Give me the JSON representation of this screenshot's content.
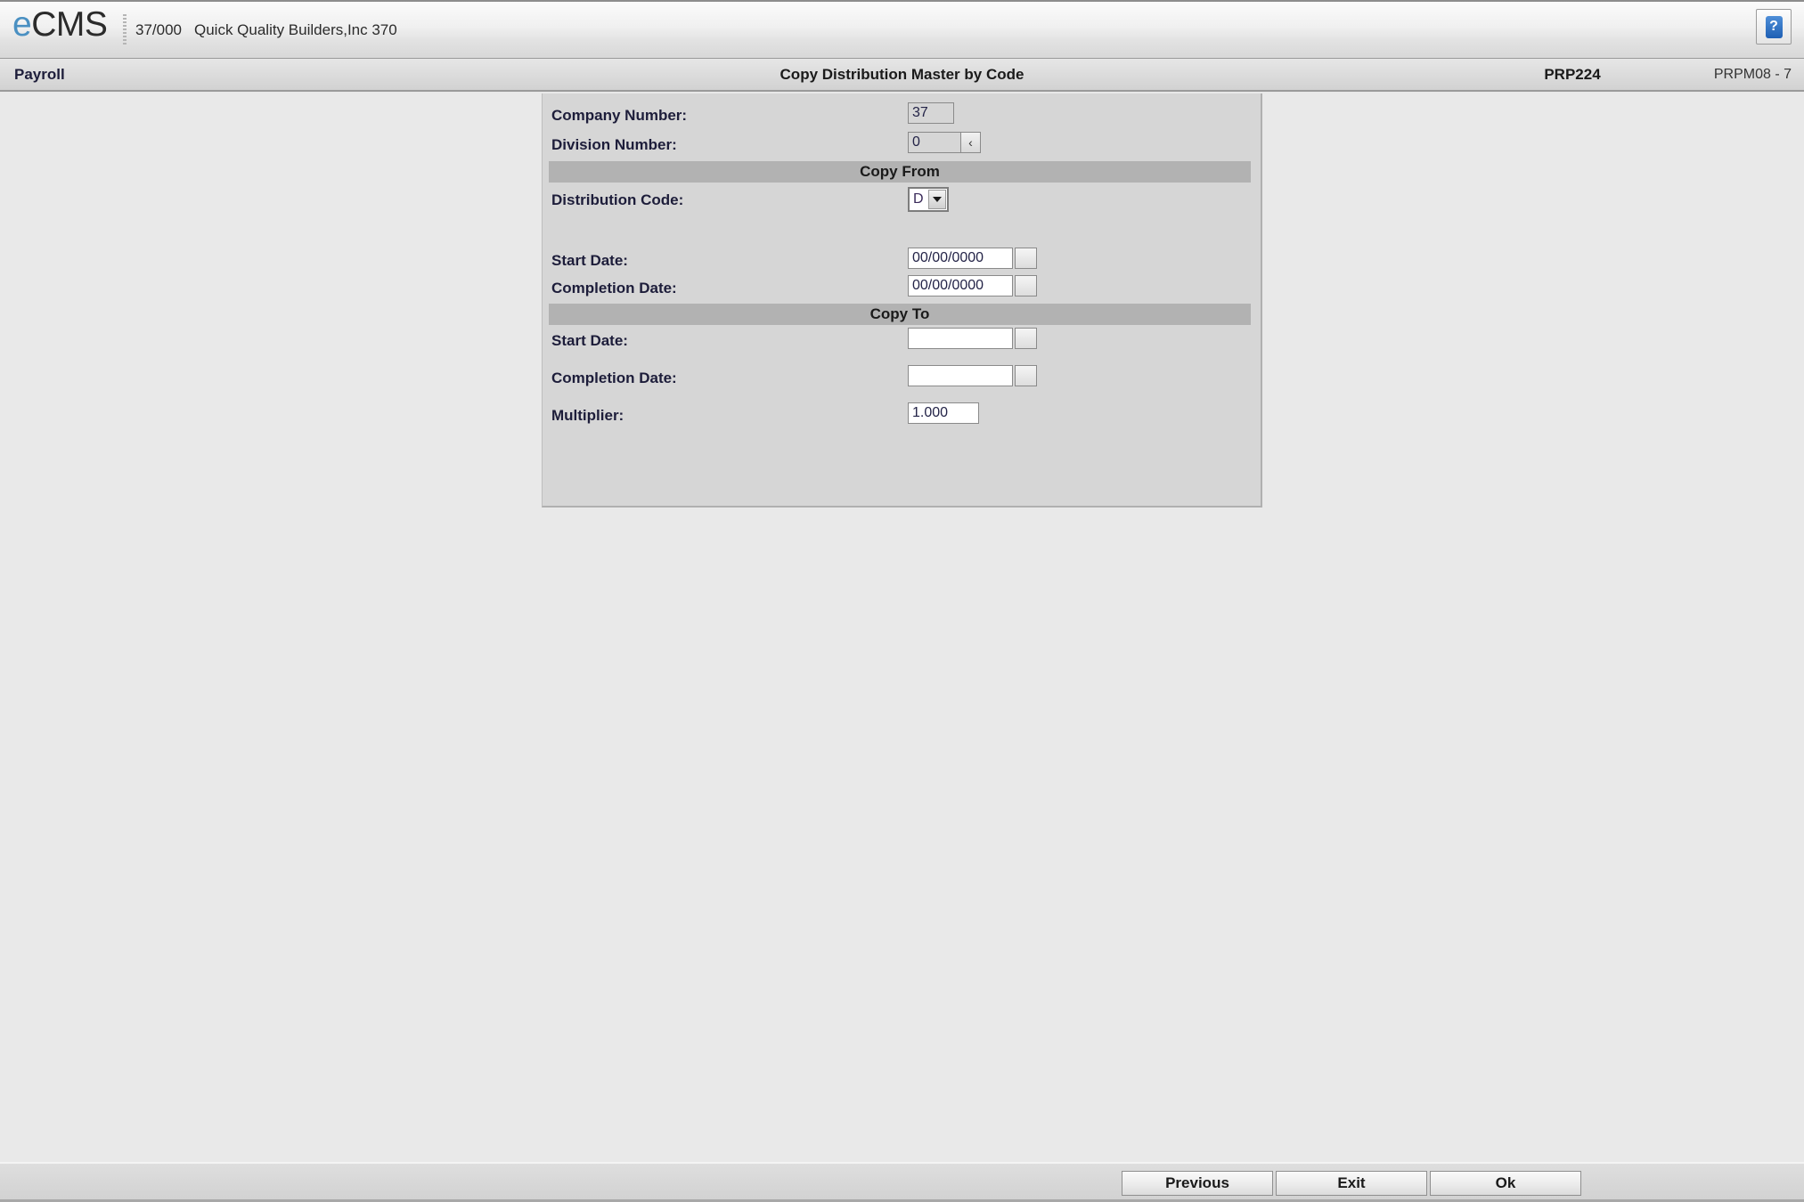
{
  "brand": {
    "logo_e": "e",
    "logo_cms": "CMS",
    "company_code": "37/000",
    "company_name": "Quick Quality Builders,Inc 370",
    "help_glyph": "?"
  },
  "titlebar": {
    "module": "Payroll",
    "screen_title": "Copy Distribution Master by Code",
    "program_id": "PRP224",
    "session_id": "PRPM08 - 7"
  },
  "form": {
    "company_number": {
      "label": "Company Number:",
      "value": "37"
    },
    "division_number": {
      "label": "Division Number:",
      "value": "0",
      "lookup_glyph": "‹"
    },
    "copy_from_band": "Copy From",
    "distribution_code": {
      "label": "Distribution Code:",
      "value": "D",
      "options": [
        "D"
      ]
    },
    "from_start_date": {
      "label": "Start Date:",
      "value": "00/00/0000",
      "placeholder": ""
    },
    "from_completion_date": {
      "label": "Completion Date:",
      "value": "00/00/0000",
      "placeholder": ""
    },
    "copy_to_band": "Copy To",
    "to_start_date": {
      "label": "Start Date:",
      "value": "",
      "placeholder": ""
    },
    "to_completion_date": {
      "label": "Completion Date:",
      "value": "",
      "placeholder": ""
    },
    "multiplier": {
      "label": "Multiplier:",
      "value": "1.000"
    }
  },
  "buttons": {
    "previous": "Previous",
    "exit": "Exit",
    "ok": "Ok"
  },
  "colors": {
    "accent_blue": "#4a90c2",
    "label_navy": "#1d1d3a",
    "band_gray": "#b2b2b2",
    "panel_gray": "#d6d6d6",
    "page_bg": "#e9e9e9"
  }
}
